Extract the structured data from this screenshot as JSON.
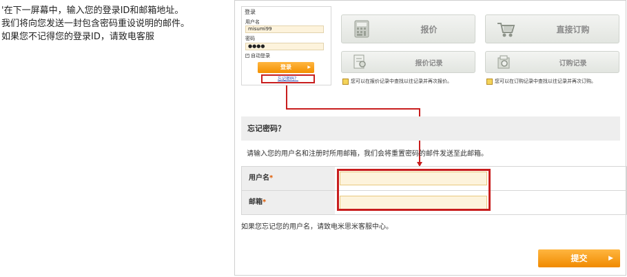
{
  "intro": {
    "line1": "'在下一屏幕中，输入您的登录ID和邮箱地址。",
    "line2": "我们将向您发送一封包含密码重设说明的邮件。",
    "line3": "如果您不记得您的登录ID，请致电客服"
  },
  "login": {
    "title": "登录",
    "username_label": "用户名",
    "username_value": "misumi99",
    "password_label": "密码",
    "password_value": "●●●●",
    "auto_login": "自动登录",
    "login_button": "登录",
    "forgot_link": "忘记密码？"
  },
  "tiles": {
    "quote": "报价",
    "direct_order": "直接订购",
    "quote_history": "报价记录",
    "order_history": "订购记录",
    "quote_note": "您可以在报价记录中查找以往记录并再次报价。",
    "order_note": "您可以在订购记录中查找以往记录并再次订购。"
  },
  "forgot": {
    "title": "忘记密码？",
    "description": "请输入您的用户名和注册时所用邮箱，我们会将重置密码的邮件发送至此邮箱。",
    "username_label": "用户名",
    "email_label": "邮箱",
    "required_mark": "*",
    "footer": "如果您忘记您的用户名，请致电米思米客服中心。",
    "submit": "提交"
  },
  "colors": {
    "accent_orange": "#f39000",
    "highlight_red": "#c81d1d",
    "input_bg": "#fdf3dc"
  }
}
